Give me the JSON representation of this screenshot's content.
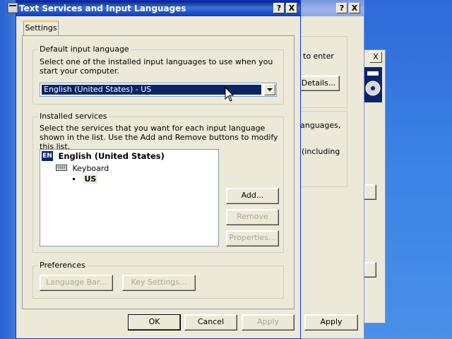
{
  "desktop": {
    "bg_color": "#3a6ea5"
  },
  "background_window_a": {
    "visible_texts": [
      "to enter",
      "Details...",
      "anguages,",
      "(including"
    ],
    "help_glyph": "?",
    "close_glyph": "X",
    "details_button_label": "Details..."
  },
  "background_window_b": {
    "close_glyph": "X",
    "ok_label": "",
    "apply_label": "Apply"
  },
  "dialog": {
    "title": "Text Services and Input Languages",
    "help_glyph": "?",
    "close_glyph": "X",
    "tabs": [
      {
        "label": "Settings"
      }
    ],
    "default_language": {
      "group_label": "Default input language",
      "description": "Select one of the installed input languages to use when you start your computer.",
      "selected_value": "English (United States) - US"
    },
    "installed_services": {
      "group_label": "Installed services",
      "description": "Select the services that you want for each input language shown in the list. Use the Add and Remove buttons to modify this list.",
      "language_badge": "EN",
      "language_name": "English (United States)",
      "category_label": "Keyboard",
      "layout_label": "US",
      "buttons": {
        "add": "Add...",
        "remove": "Remove",
        "properties": "Properties..."
      }
    },
    "preferences": {
      "group_label": "Preferences",
      "language_bar_label": "Language Bar...",
      "key_settings_label": "Key Settings..."
    },
    "footer": {
      "ok_label": "OK",
      "cancel_label": "Cancel",
      "apply_label": "Apply"
    }
  },
  "colors": {
    "title_active": "#0a246a",
    "title_inactive": "#7a96df",
    "dialog_face": "#ece9d8",
    "selection": "#0a246a"
  }
}
